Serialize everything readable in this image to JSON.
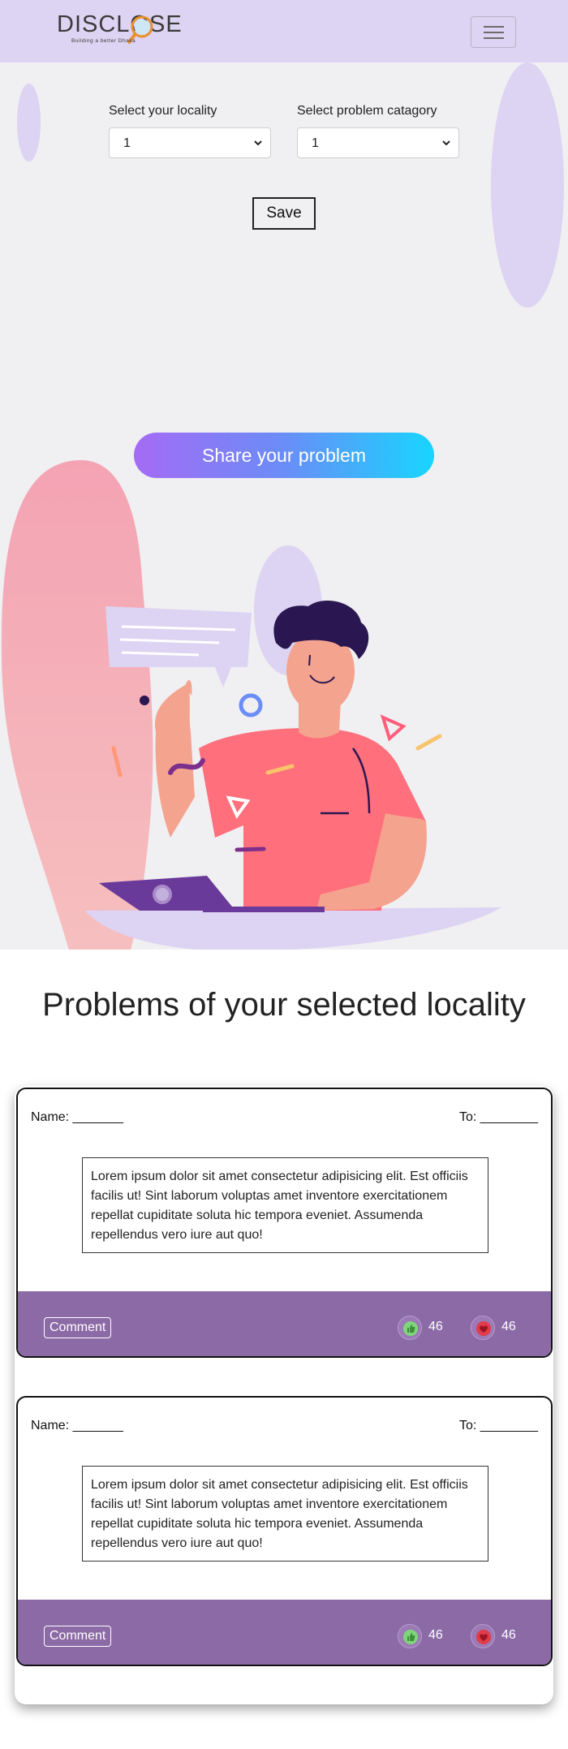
{
  "navbar": {
    "logo_text": "DISCLOSE",
    "logo_tagline": "Building a better Dhaka",
    "menu_icon": "hamburger-menu-icon"
  },
  "filters": {
    "locality_label": "Select your locality",
    "locality_value": "1",
    "category_label": "Select problem catagory",
    "category_value": "1",
    "save_label": "Save"
  },
  "hero": {
    "share_label": "Share your problem"
  },
  "problems": {
    "title": "Problems of your selected locality",
    "cards": [
      {
        "name_label": "Name: _______",
        "to_label": "To: ________",
        "text": "Lorem ipsum dolor sit amet consectetur adipisicing elit. Est officiis facilis ut! Sint laborum voluptas amet inventore exercitationem repellat cupiditate soluta hic tempora eveniet. Assumenda repellendus vero iure aut quo!",
        "comment_label": "Comment",
        "likes": "46",
        "hearts": "46"
      },
      {
        "name_label": "Name: _______",
        "to_label": "To: ________",
        "text": "Lorem ipsum dolor sit amet consectetur adipisicing elit. Est officiis facilis ut! Sint laborum voluptas amet inventore exercitationem repellat cupiditate soluta hic tempora eveniet. Assumenda repellendus vero iure aut quo!",
        "comment_label": "Comment",
        "likes": "46",
        "hearts": "46"
      }
    ]
  },
  "colors": {
    "navbar_bg": "#ddd3f2",
    "footer_purple": "#8c6aa6",
    "share_gradient_start": "#a56bf5",
    "share_gradient_end": "#17d5ff"
  }
}
